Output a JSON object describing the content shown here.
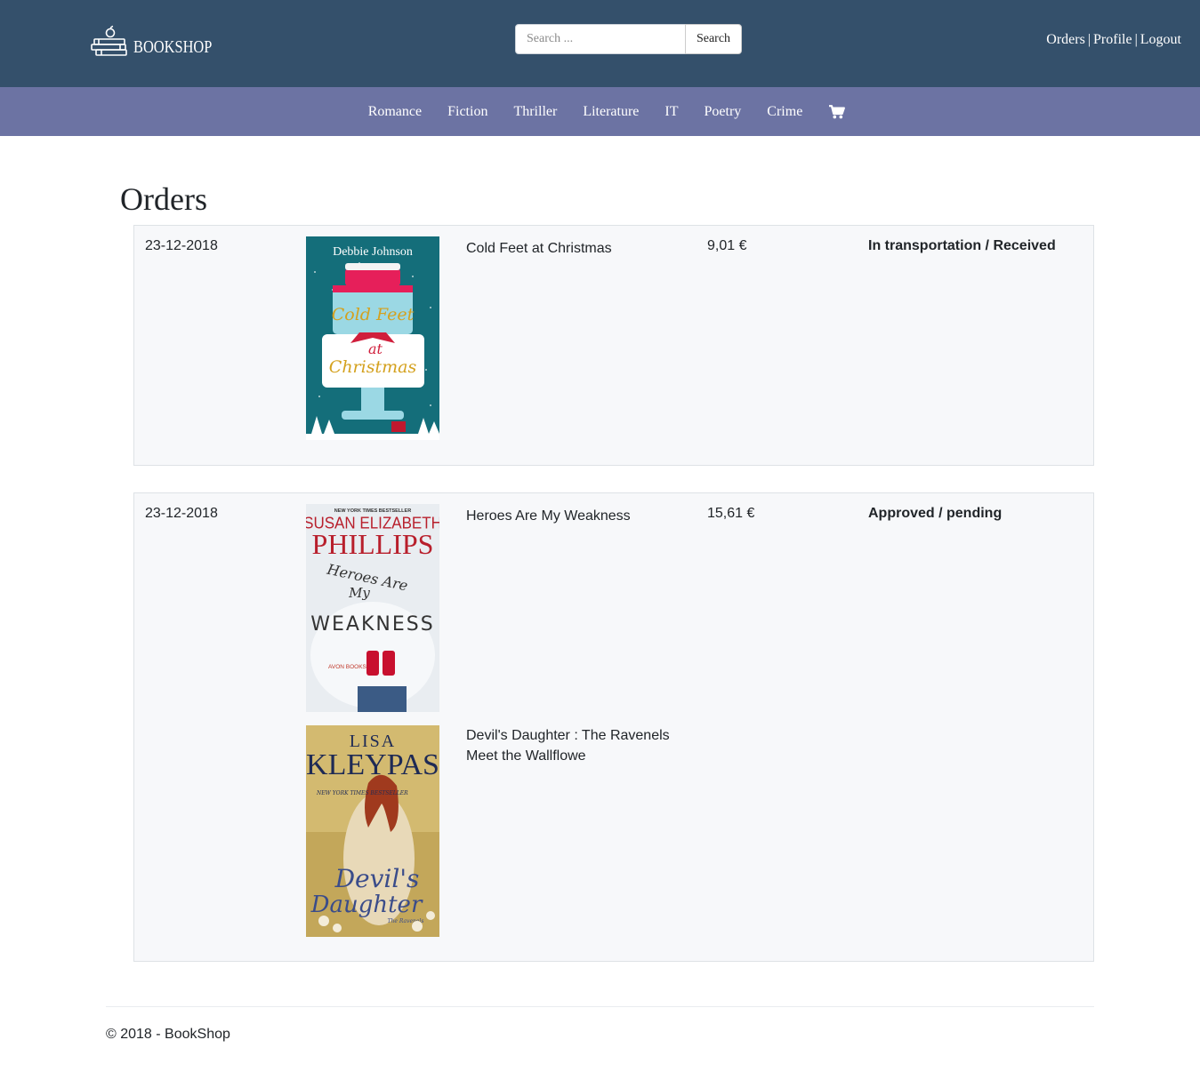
{
  "header": {
    "brand": "BOOKSHOP",
    "search": {
      "placeholder": "Search ...",
      "value": "",
      "button_label": "Search"
    },
    "links": {
      "orders": "Orders",
      "profile": "Profile",
      "logout": "Logout",
      "separator": "|"
    }
  },
  "categories": [
    "Romance",
    "Fiction",
    "Thriller",
    "Literature",
    "IT",
    "Poetry",
    "Crime"
  ],
  "cart_icon": "shopping-cart-icon",
  "page_title": "Orders",
  "orders": [
    {
      "date": "23-12-2018",
      "price": "9,01 €",
      "status": "In transportation / Received",
      "items": [
        {
          "title": "Cold Feet at Christmas",
          "cover": {
            "author_top": "Debbie Johnson",
            "title_line1": "Cold Feet",
            "title_line2": "at",
            "title_line3": "Christmas"
          }
        }
      ]
    },
    {
      "date": "23-12-2018",
      "price": "15,61 €",
      "status": "Approved / pending",
      "items": [
        {
          "title": "Heroes Are My Weakness",
          "cover": {
            "tagline": "NEW YORK TIMES BESTSELLER",
            "author_line1": "SUSAN ELIZABETH",
            "author_line2": "PHILLIPS",
            "title_line1": "Heroes Are",
            "title_line2": "My",
            "title_line3": "WEAKNESS",
            "publisher": "AVON BOOKS"
          }
        },
        {
          "title": "Devil's Daughter : The Ravenels Meet the Wallflowe",
          "cover": {
            "author_line1": "LISA",
            "author_line2": "KLEYPAS",
            "tagline": "NEW YORK TIMES BESTSELLER",
            "title_line1": "Devil's",
            "title_line2": "Daughter",
            "subtitle": "The Ravenels"
          }
        }
      ]
    }
  ],
  "footer": {
    "text": "© 2018 - BookShop"
  },
  "colors": {
    "header_bg": "#34506b",
    "category_bg": "#6c73a3",
    "order_bg": "#f7f8fa",
    "order_border": "#dee2e6"
  }
}
